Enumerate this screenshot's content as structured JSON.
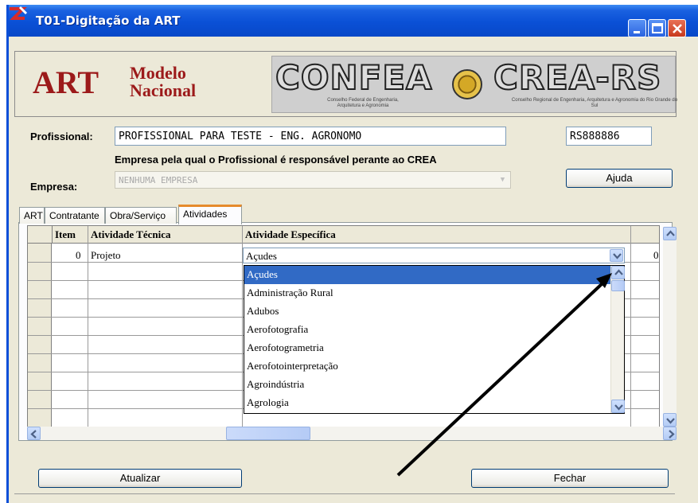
{
  "window": {
    "title": "T01-Digitação da ART"
  },
  "logo": {
    "art": "ART",
    "modelo_line1": "Modelo",
    "modelo_line2": "Nacional",
    "confea": "CONFEA",
    "confea_sub": "Conselho Federal de Engenharia, Arquitetura e Agronomia",
    "crea": "CREA-RS",
    "crea_sub": "Conselho Regional de Engenharia, Arquitetura e Agronomia do Rio Grande do Sul"
  },
  "form": {
    "profissional_label": "Profissional:",
    "profissional_value": "PROFISSIONAL PARA TESTE - ENG. AGRONOMO",
    "registro_value": "RS888886",
    "empresa_hint": "Empresa pela qual o Profissional é responsável  perante ao CREA",
    "empresa_label": "Empresa:",
    "empresa_value": "NENHUMA EMPRESA",
    "ajuda_label": "Ajuda"
  },
  "tabs": [
    "ART",
    "Contratante",
    "Obra/Serviço",
    "Atividades"
  ],
  "active_tab": "Atividades",
  "grid": {
    "headers": [
      "Item",
      "Atividade Técnica",
      "Atividade Específica"
    ],
    "row": {
      "item": "0",
      "tecnica": "Projeto",
      "especifica": "Açudes",
      "extra": "0"
    }
  },
  "dropdown": {
    "selected": "Açudes",
    "options": [
      "Açudes",
      "Administração Rural",
      "Adubos",
      "Aerofotografia",
      "Aerofotogrametria",
      "Aerofotointerpretação",
      "Agroindústria",
      "Agrologia"
    ]
  },
  "buttons": {
    "atualizar": "Atualizar",
    "fechar": "Fechar"
  },
  "colors": {
    "title_bar": "#0a50d6",
    "brand_red": "#9c1a1a",
    "selection": "#316ac5",
    "tab_highlight": "#e68b2c"
  }
}
